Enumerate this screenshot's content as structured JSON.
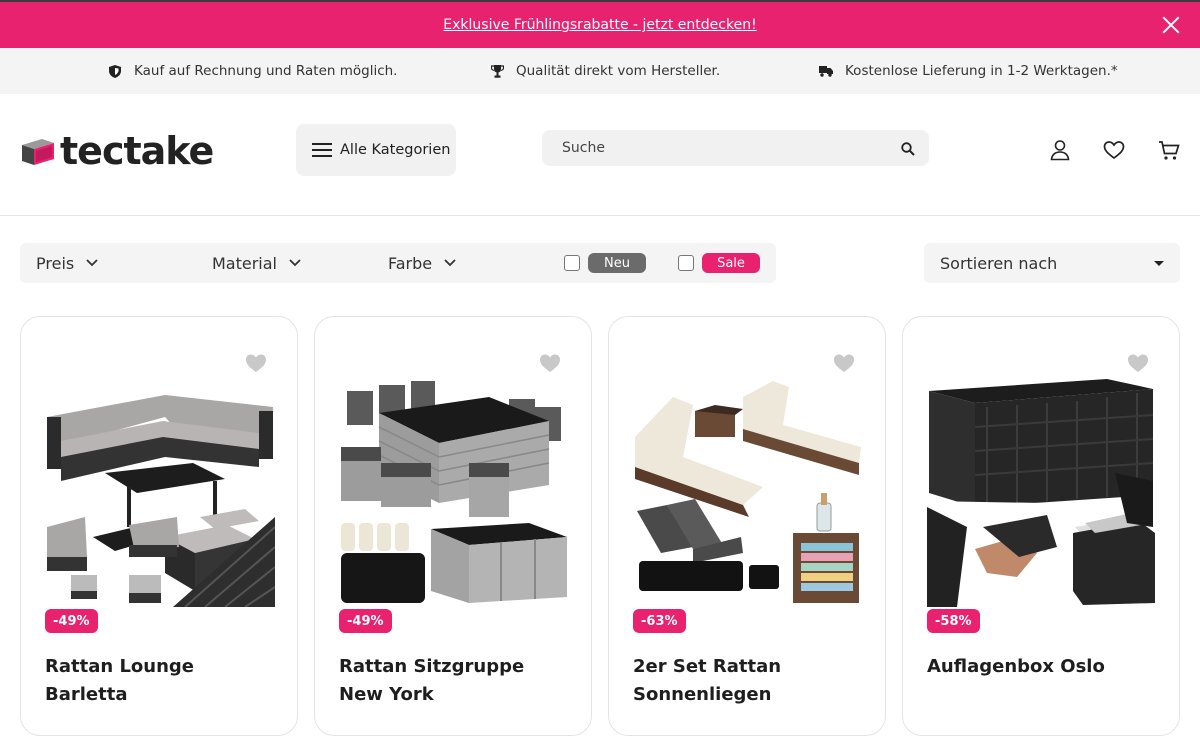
{
  "promo": {
    "text": "Exklusive Frühlingsrabatte - jetzt entdecken!"
  },
  "usp": [
    {
      "icon": "shield-icon",
      "text": "Kauf auf Rechnung und Raten möglich."
    },
    {
      "icon": "trophy-icon",
      "text": "Qualität direkt vom Hersteller."
    },
    {
      "icon": "truck-icon",
      "text": "Kostenlose Lieferung in 1-2 Werktagen.*"
    }
  ],
  "header": {
    "logo": "tectake",
    "categories_label": "Alle Kategorien",
    "search_placeholder": "Suche"
  },
  "filters": {
    "price": "Preis",
    "material": "Material",
    "color": "Farbe",
    "new_label": "Neu",
    "sale_label": "Sale",
    "sort_label": "Sortieren nach"
  },
  "colors": {
    "brand_pink": "#e8226e",
    "neu_gray": "#6b6b6b"
  },
  "products": [
    {
      "title": "Rattan Lounge Barletta",
      "discount": "-49%"
    },
    {
      "title": "Rattan Sitzgruppe New York",
      "discount": "-49%"
    },
    {
      "title": "2er Set Rattan Sonnenliegen",
      "discount": "-63%"
    },
    {
      "title": "Auflagenbox Oslo",
      "discount": "-58%"
    }
  ]
}
